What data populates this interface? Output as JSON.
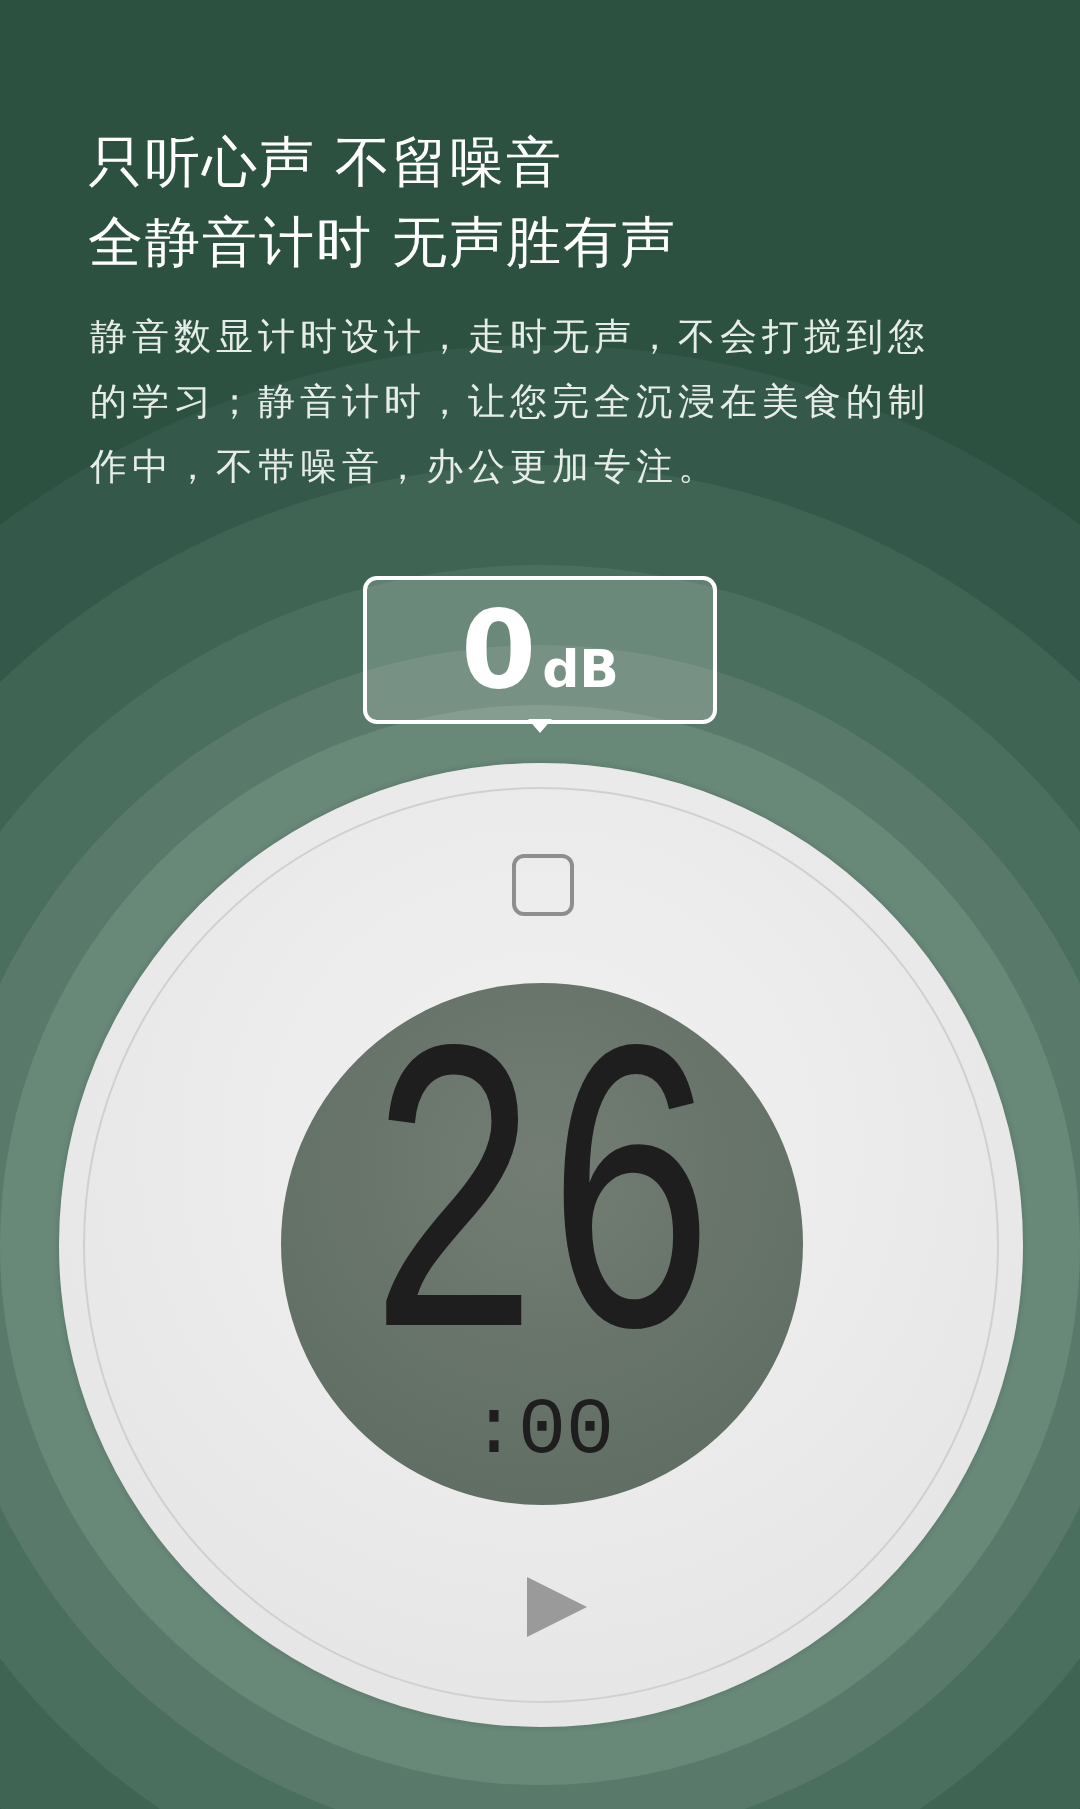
{
  "headline": [
    "只听心声 不留噪音",
    "全静音计时 无声胜有声"
  ],
  "description": "静音数显计时设计，走时无声，不会打搅到您的学习；静音计时，让您完全沉浸在美食的制作中，不带噪音，办公更加专注。",
  "badge": {
    "value": "0",
    "unit": "dB"
  },
  "display": {
    "minutes": "26",
    "seconds": ":00"
  }
}
